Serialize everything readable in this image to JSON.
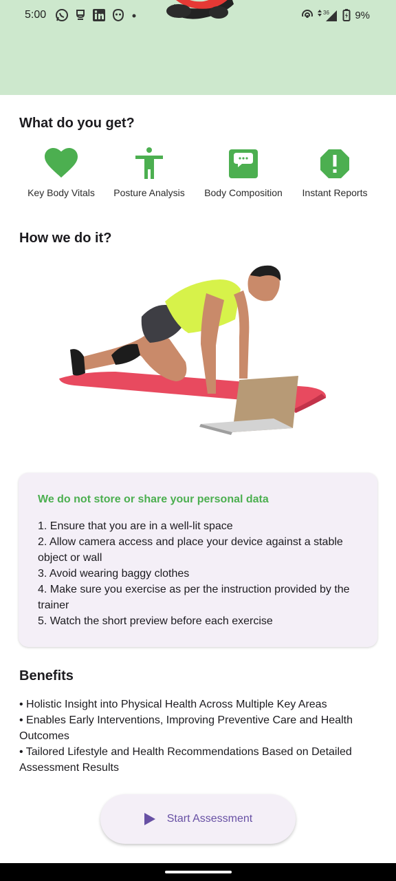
{
  "status_bar": {
    "time": "5:00",
    "battery": "9%",
    "network": "36",
    "left_icons": [
      "whatsapp-icon",
      "chat-bubble-icon",
      "linkedin-icon",
      "emoji-icon",
      "dot-icon"
    ],
    "right_icons": [
      "hotspot-icon",
      "signal-icon",
      "battery-icon"
    ]
  },
  "sections": {
    "what_title": "What do you get?",
    "how_title": "How we do it?",
    "benefits_title": "Benefits"
  },
  "features": [
    {
      "label": "Key Body Vitals",
      "icon": "heart-icon"
    },
    {
      "label": "Posture Analysis",
      "icon": "person-posture-icon"
    },
    {
      "label": "Body Composition",
      "icon": "message-box-icon"
    },
    {
      "label": "Instant Reports",
      "icon": "alert-octagon-icon"
    }
  ],
  "info_card": {
    "title": "We do not store or share your personal data",
    "items": [
      "1. Ensure that you are in a well-lit space",
      "2. Allow camera access and place your device against a stable object or wall",
      "3. Avoid wearing baggy clothes",
      "4. Make sure you exercise as per the instruction provided by the trainer",
      "5. Watch the short preview before each exercise"
    ]
  },
  "benefits": [
    "• Holistic Insight into Physical Health Across Multiple Key Areas",
    "• Enables Early Interventions, Improving Preventive Care and Health Outcomes",
    "• Tailored Lifestyle and Health Recommendations Based on Detailed Assessment Results"
  ],
  "start_button": {
    "label": "Start Assessment",
    "icon": "play-icon"
  },
  "colors": {
    "accent_green": "#4caf50",
    "hero_bg": "#cde8cd",
    "card_bg": "#f4eff7",
    "button_text": "#6750a4"
  }
}
